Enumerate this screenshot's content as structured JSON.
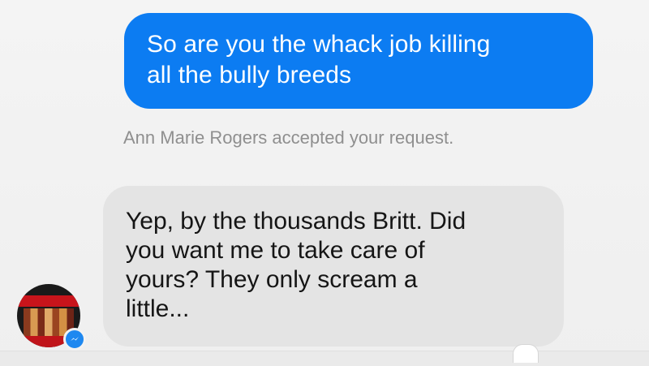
{
  "messages": {
    "outgoing": {
      "lines": [
        "So are you the whack job killing",
        "all the bully breeds"
      ]
    },
    "system_note": "Ann Marie Rogers accepted your request.",
    "incoming": {
      "lines": [
        "Yep, by the thousands Britt. Did",
        "you want me to take care of",
        "yours? They only scream a",
        "little..."
      ]
    }
  },
  "icons": {
    "avatar": "contact-avatar",
    "badge": "messenger-icon"
  },
  "colors": {
    "outgoing_bubble": "#0c7cf2",
    "incoming_bubble": "#e4e4e4",
    "background": "#f2f2f2",
    "system_text": "#8f8f8f"
  }
}
